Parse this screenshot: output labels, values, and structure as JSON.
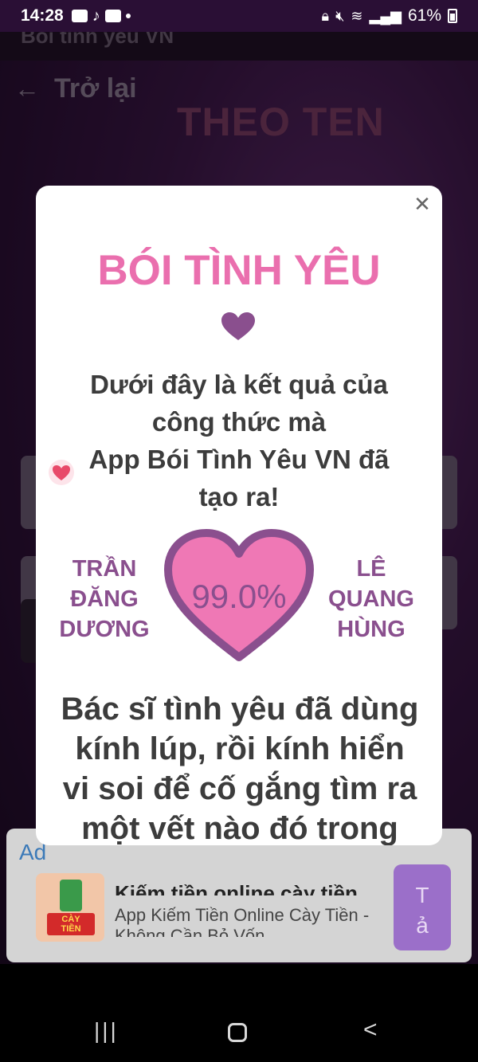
{
  "status_bar": {
    "time": "14:28",
    "battery": "61%"
  },
  "background_app": {
    "app_bar_title": "Bói tình yêu VN",
    "back_label": "Trở lại",
    "page_title": "THEO TEN"
  },
  "dialog": {
    "title": "BÓI TÌNH YÊU",
    "intro_lines": [
      "Dưới đây là kết quả của",
      "công thức mà",
      "App Bói Tình Yêu VN đã",
      "tạo ra!"
    ],
    "name_left": [
      "TRẦN",
      "ĐĂNG",
      "DƯƠNG"
    ],
    "name_right": [
      "LÊ",
      "QUANG",
      "HÙNG"
    ],
    "percent": "99.0%",
    "result_lines": [
      "Bác sĩ tình yêu đã dùng",
      "kính lúp, rồi kính hiển",
      "vi soi để cố gắng tìm ra",
      "một vết nào đó trong"
    ],
    "heart_color": "#ef78b5",
    "heart_border_color": "#8a4f8e",
    "title_color": "#ea6fae"
  },
  "ad": {
    "label": "Ad",
    "headline": "Kiếm tiền online cày tiền",
    "description": "App Kiếm Tiền Online Cày Tiền - Không Cần Bỏ Vốn",
    "cta": "Tả"
  }
}
